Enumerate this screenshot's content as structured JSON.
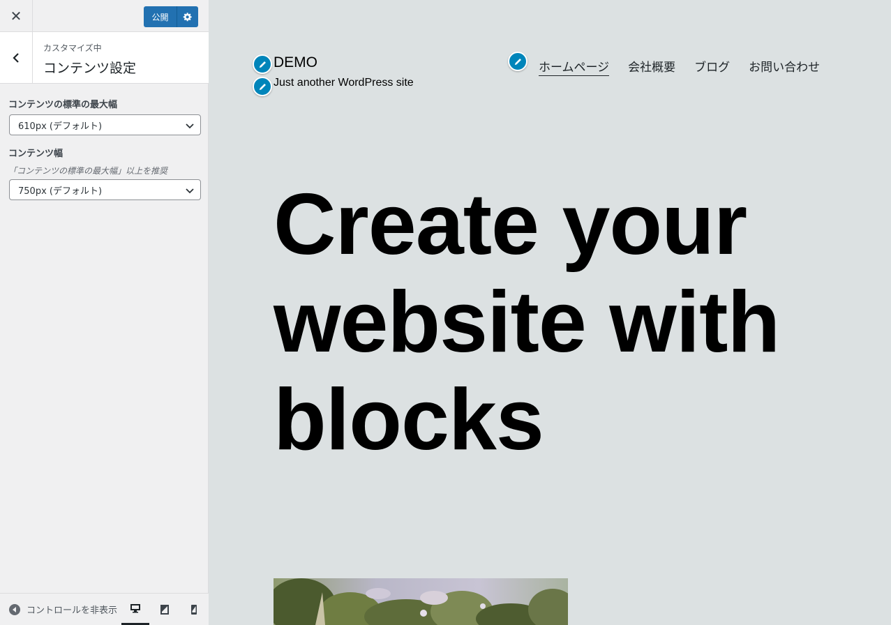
{
  "sidebar": {
    "close_icon": "close-icon",
    "publish_label": "公開",
    "publish_settings_icon": "gear-icon",
    "section": {
      "subtitle": "カスタマイズ中",
      "title": "コンテンツ設定"
    },
    "controls": [
      {
        "label": "コンテンツの標準の最大幅",
        "description": "",
        "selected": "610px (デフォルト)"
      },
      {
        "label": "コンテンツ幅",
        "description": "「コンテンツの標準の最大幅」以上を推奨",
        "selected": "750px (デフォルト)"
      }
    ],
    "footer": {
      "hide_controls_label": "コントロールを非表示",
      "devices": [
        "desktop",
        "tablet",
        "mobile"
      ],
      "active_device": "desktop"
    }
  },
  "preview": {
    "site_title": "DEMO",
    "site_tagline": "Just another WordPress site",
    "nav": [
      {
        "label": "ホームページ",
        "current": true
      },
      {
        "label": "会社概要",
        "current": false
      },
      {
        "label": "ブログ",
        "current": false
      },
      {
        "label": "お問い合わせ",
        "current": false
      }
    ],
    "hero_lines": [
      "Create your",
      "website with",
      "blocks"
    ]
  },
  "colors": {
    "accent": "#2271b1",
    "pencil": "#0085ba",
    "preview_bg": "#dce1e2",
    "sidebar_bg": "#f0f0f1"
  }
}
